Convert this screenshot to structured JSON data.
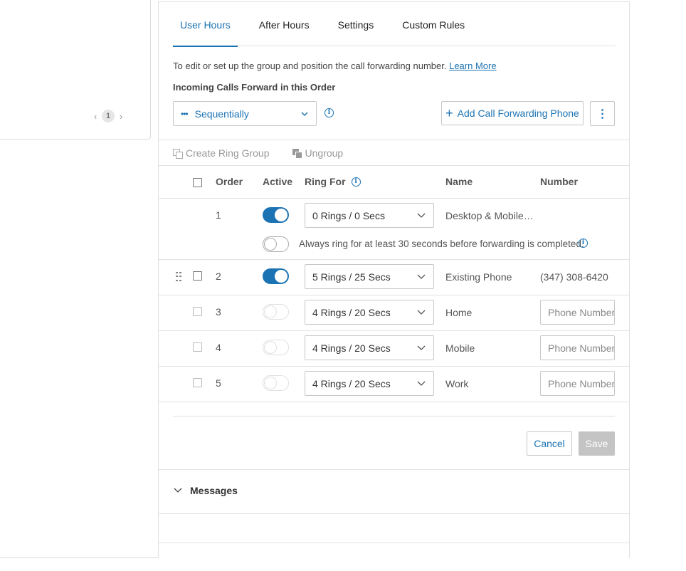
{
  "pager": {
    "prev": "‹",
    "current": "1",
    "next": "›"
  },
  "tabs": [
    {
      "label": "User Hours",
      "active": true
    },
    {
      "label": "After Hours",
      "active": false
    },
    {
      "label": "Settings",
      "active": false
    },
    {
      "label": "Custom Rules",
      "active": false
    }
  ],
  "description": {
    "text": "To edit or set up the group and position the call forwarding number.",
    "link": "Learn More"
  },
  "section_title": "Incoming Calls Forward in this Order",
  "order_select": {
    "value": "Sequentially"
  },
  "add_button": {
    "label": "Add Call Forwarding Phone"
  },
  "group_actions": {
    "create": "Create Ring Group",
    "ungroup": "Ungroup"
  },
  "table": {
    "headers": {
      "order": "Order",
      "active": "Active",
      "ring_for": "Ring For",
      "name": "Name",
      "number": "Number"
    },
    "rows": [
      {
        "order": "1",
        "active": true,
        "ring_for": "0 Rings / 0 Secs",
        "name": "Desktop & Mobile…",
        "number": ""
      },
      {
        "order": "2",
        "active": true,
        "ring_for": "5 Rings / 25 Secs",
        "name": "Existing Phone",
        "number": "(347) 308-6420"
      },
      {
        "order": "3",
        "active": false,
        "ring_for": "4 Rings / 20 Secs",
        "name": "Home",
        "number_placeholder": "Phone Number"
      },
      {
        "order": "4",
        "active": false,
        "ring_for": "4 Rings / 20 Secs",
        "name": "Mobile",
        "number_placeholder": "Phone Number"
      },
      {
        "order": "5",
        "active": false,
        "ring_for": "4 Rings / 20 Secs",
        "name": "Work",
        "number_placeholder": "Phone Number"
      }
    ],
    "always_ring_text": "Always ring for at least 30 seconds before forwarding is completed."
  },
  "buttons": {
    "cancel": "Cancel",
    "save": "Save"
  },
  "messages_section": {
    "label": "Messages"
  },
  "colors": {
    "accent": "#1c73b3",
    "border": "#c8c8c8",
    "disabled": "#c4c4c4"
  }
}
